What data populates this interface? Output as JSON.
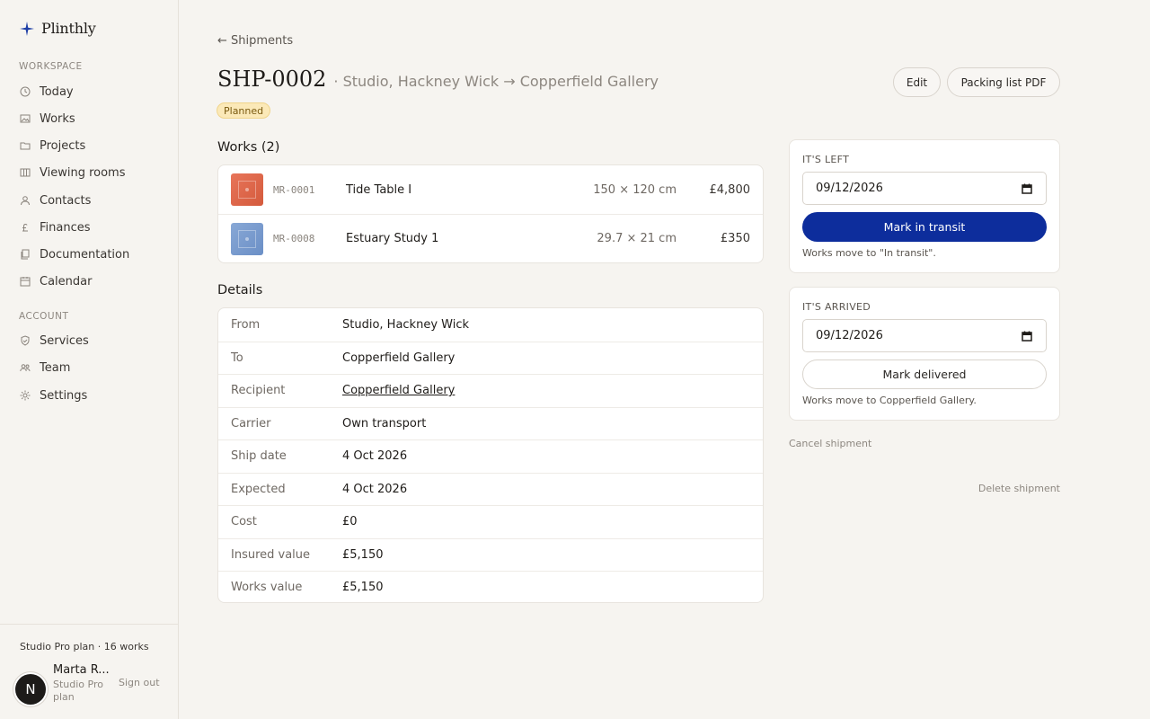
{
  "app": {
    "name": "Plinthly"
  },
  "sidebar": {
    "workspace_label": "WORKSPACE",
    "workspace_items": [
      {
        "label": "Today",
        "icon": "clock-icon"
      },
      {
        "label": "Works",
        "icon": "image-icon"
      },
      {
        "label": "Projects",
        "icon": "folder-icon"
      },
      {
        "label": "Viewing rooms",
        "icon": "columns-icon"
      },
      {
        "label": "Contacts",
        "icon": "person-icon"
      },
      {
        "label": "Finances",
        "icon": "pound-icon"
      },
      {
        "label": "Documentation",
        "icon": "documents-icon"
      },
      {
        "label": "Calendar",
        "icon": "calendar-icon"
      }
    ],
    "account_label": "ACCOUNT",
    "account_items": [
      {
        "label": "Services",
        "icon": "shield-icon"
      },
      {
        "label": "Team",
        "icon": "team-icon"
      },
      {
        "label": "Settings",
        "icon": "sun-gear-icon"
      }
    ],
    "footer": {
      "plan_line": "Studio Pro plan · 16 works",
      "avatar_letter": "N",
      "user_name": "Marta R...",
      "user_plan": "Studio Pro plan",
      "sign_out": "Sign out"
    }
  },
  "header": {
    "back_label": "← Shipments",
    "shipment_id": "SHP-0002",
    "route": "· Studio, Hackney Wick → Copperfield Gallery",
    "status": "Planned",
    "edit_label": "Edit",
    "pdf_label": "Packing list PDF"
  },
  "works": {
    "title": "Works (2)",
    "items": [
      {
        "code": "MR-0001",
        "title": "Tide Table I",
        "dims": "150 × 120 cm",
        "price": "£4,800",
        "thumb_color": "#e0684a"
      },
      {
        "code": "MR-0008",
        "title": "Estuary Study 1",
        "dims": "29.7 × 21 cm",
        "price": "£350",
        "thumb_color": "#7a9ccf"
      }
    ]
  },
  "details": {
    "title": "Details",
    "rows": [
      {
        "label": "From",
        "value": "Studio, Hackney Wick"
      },
      {
        "label": "To",
        "value": "Copperfield Gallery"
      },
      {
        "label": "Recipient",
        "value": "Copperfield Gallery"
      },
      {
        "label": "Carrier",
        "value": "Own transport"
      },
      {
        "label": "Ship date",
        "value": "4 Oct 2026"
      },
      {
        "label": "Expected",
        "value": "4 Oct 2026"
      },
      {
        "label": "Cost",
        "value": "£0"
      },
      {
        "label": "Insured value",
        "value": "£5,150"
      },
      {
        "label": "Works value",
        "value": "£5,150"
      }
    ]
  },
  "left_panel": {
    "label": "IT'S LEFT",
    "date": "09/12/2026",
    "button": "Mark in transit",
    "note": "Works move to \"In transit\"."
  },
  "arrived_panel": {
    "label": "IT'S ARRIVED",
    "date": "09/12/2026",
    "button": "Mark delivered",
    "note": "Works move to Copperfield Gallery."
  },
  "actions": {
    "cancel": "Cancel shipment",
    "delete": "Delete shipment"
  },
  "colors": {
    "primary": "#0d2d9c",
    "badge_bg": "#fbe9b8",
    "brand": "#1f3fa6"
  }
}
